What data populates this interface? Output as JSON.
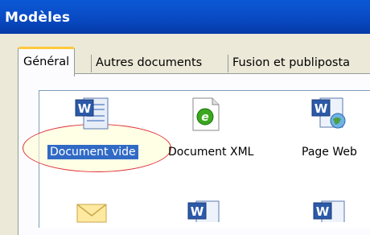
{
  "window": {
    "title": "Modèles"
  },
  "tabs": [
    {
      "label": "Général",
      "active": true
    },
    {
      "label": "Autres documents",
      "active": false
    },
    {
      "label": "Fusion et publiposta",
      "active": false
    }
  ],
  "templates": [
    {
      "label": "Document vide",
      "icon": "word-document-icon",
      "selected": true
    },
    {
      "label": "Document XML",
      "icon": "xml-document-icon",
      "selected": false
    },
    {
      "label": "Page Web",
      "icon": "web-page-icon",
      "selected": false
    },
    {
      "label": "",
      "icon": "email-envelope-icon",
      "selected": false
    },
    {
      "label": "",
      "icon": "word-document-icon",
      "selected": false
    },
    {
      "label": "",
      "icon": "word-document-icon",
      "selected": false
    }
  ],
  "colors": {
    "title_bar": "#0848c0",
    "selection": "#316ac5",
    "tab_hot_border": "#ffc83c",
    "annotation_ellipse": "#e0303a"
  }
}
